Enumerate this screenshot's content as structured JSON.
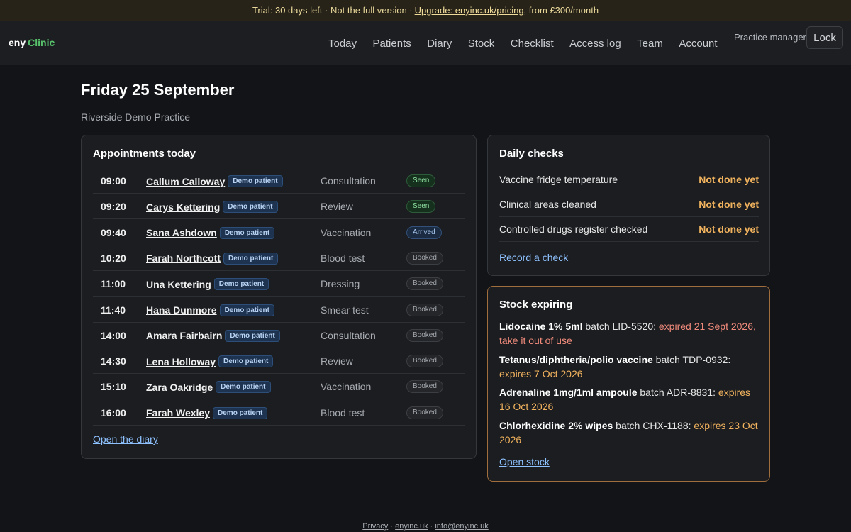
{
  "trial": {
    "text": "Trial: 30 days left · Not the full version ·",
    "link": "Upgrade: enyinc.uk/pricing",
    "suffix": ", from £300/month"
  },
  "brand": {
    "part1": "eny",
    "part2": "Clinic",
    "accent_color": "#57c26b"
  },
  "nav": [
    "Today",
    "Patients",
    "Diary",
    "Stock",
    "Checklist",
    "Access log",
    "Team",
    "Account"
  ],
  "user": {
    "role": "Practice manager",
    "lock_label": "Lock"
  },
  "page": {
    "title": "Friday 25 September",
    "practice": "Riverside Demo Practice"
  },
  "appointments": {
    "title": "Appointments today",
    "demo_tag": "Demo patient",
    "rows": [
      {
        "time": "09:00",
        "name": "Callum Calloway",
        "type": "Consultation",
        "status": "Seen"
      },
      {
        "time": "09:20",
        "name": "Carys Kettering",
        "type": "Review",
        "status": "Seen"
      },
      {
        "time": "09:40",
        "name": "Sana Ashdown",
        "type": "Vaccination",
        "status": "Arrived"
      },
      {
        "time": "10:20",
        "name": "Farah Northcott",
        "type": "Blood test",
        "status": "Booked"
      },
      {
        "time": "11:00",
        "name": "Una Kettering",
        "type": "Dressing",
        "status": "Booked"
      },
      {
        "time": "11:40",
        "name": "Hana Dunmore",
        "type": "Smear test",
        "status": "Booked"
      },
      {
        "time": "14:00",
        "name": "Amara Fairbairn",
        "type": "Consultation",
        "status": "Booked"
      },
      {
        "time": "14:30",
        "name": "Lena Holloway",
        "type": "Review",
        "status": "Booked"
      },
      {
        "time": "15:10",
        "name": "Zara Oakridge",
        "type": "Vaccination",
        "status": "Booked"
      },
      {
        "time": "16:00",
        "name": "Farah Wexley",
        "type": "Blood test",
        "status": "Booked"
      }
    ],
    "open_link": "Open the diary"
  },
  "checks": {
    "title": "Daily checks",
    "rows": [
      {
        "label": "Vaccine fridge temperature",
        "status": "Not done yet"
      },
      {
        "label": "Clinical areas cleaned",
        "status": "Not done yet"
      },
      {
        "label": "Controlled drugs register checked",
        "status": "Not done yet"
      }
    ],
    "record_link": "Record a check",
    "status_color": "#f2b35e"
  },
  "stock": {
    "title": "Stock expiring",
    "items": [
      {
        "name": "Lidocaine 1% 5ml",
        "batch": " batch LID-5520: ",
        "note": "expired 21 Sept 2026, take it out of use",
        "kind": "expired"
      },
      {
        "name": "Tetanus/diphtheria/polio vaccine",
        "batch": " batch TDP-0932: ",
        "note": "expires 7 Oct 2026",
        "kind": "expires"
      },
      {
        "name": "Adrenaline 1mg/1ml ampoule",
        "batch": " batch ADR-8831: ",
        "note": "expires 16 Oct 2026",
        "kind": "expires"
      },
      {
        "name": "Chlorhexidine 2% wipes",
        "batch": " batch CHX-1188: ",
        "note": "expires 23 Oct 2026",
        "kind": "expires"
      }
    ],
    "open_link": "Open stock",
    "border_color": "#a06d3c"
  },
  "footer": {
    "links": [
      "Privacy",
      "enyinc.uk",
      "info@enyinc.uk"
    ],
    "separator": " · "
  }
}
